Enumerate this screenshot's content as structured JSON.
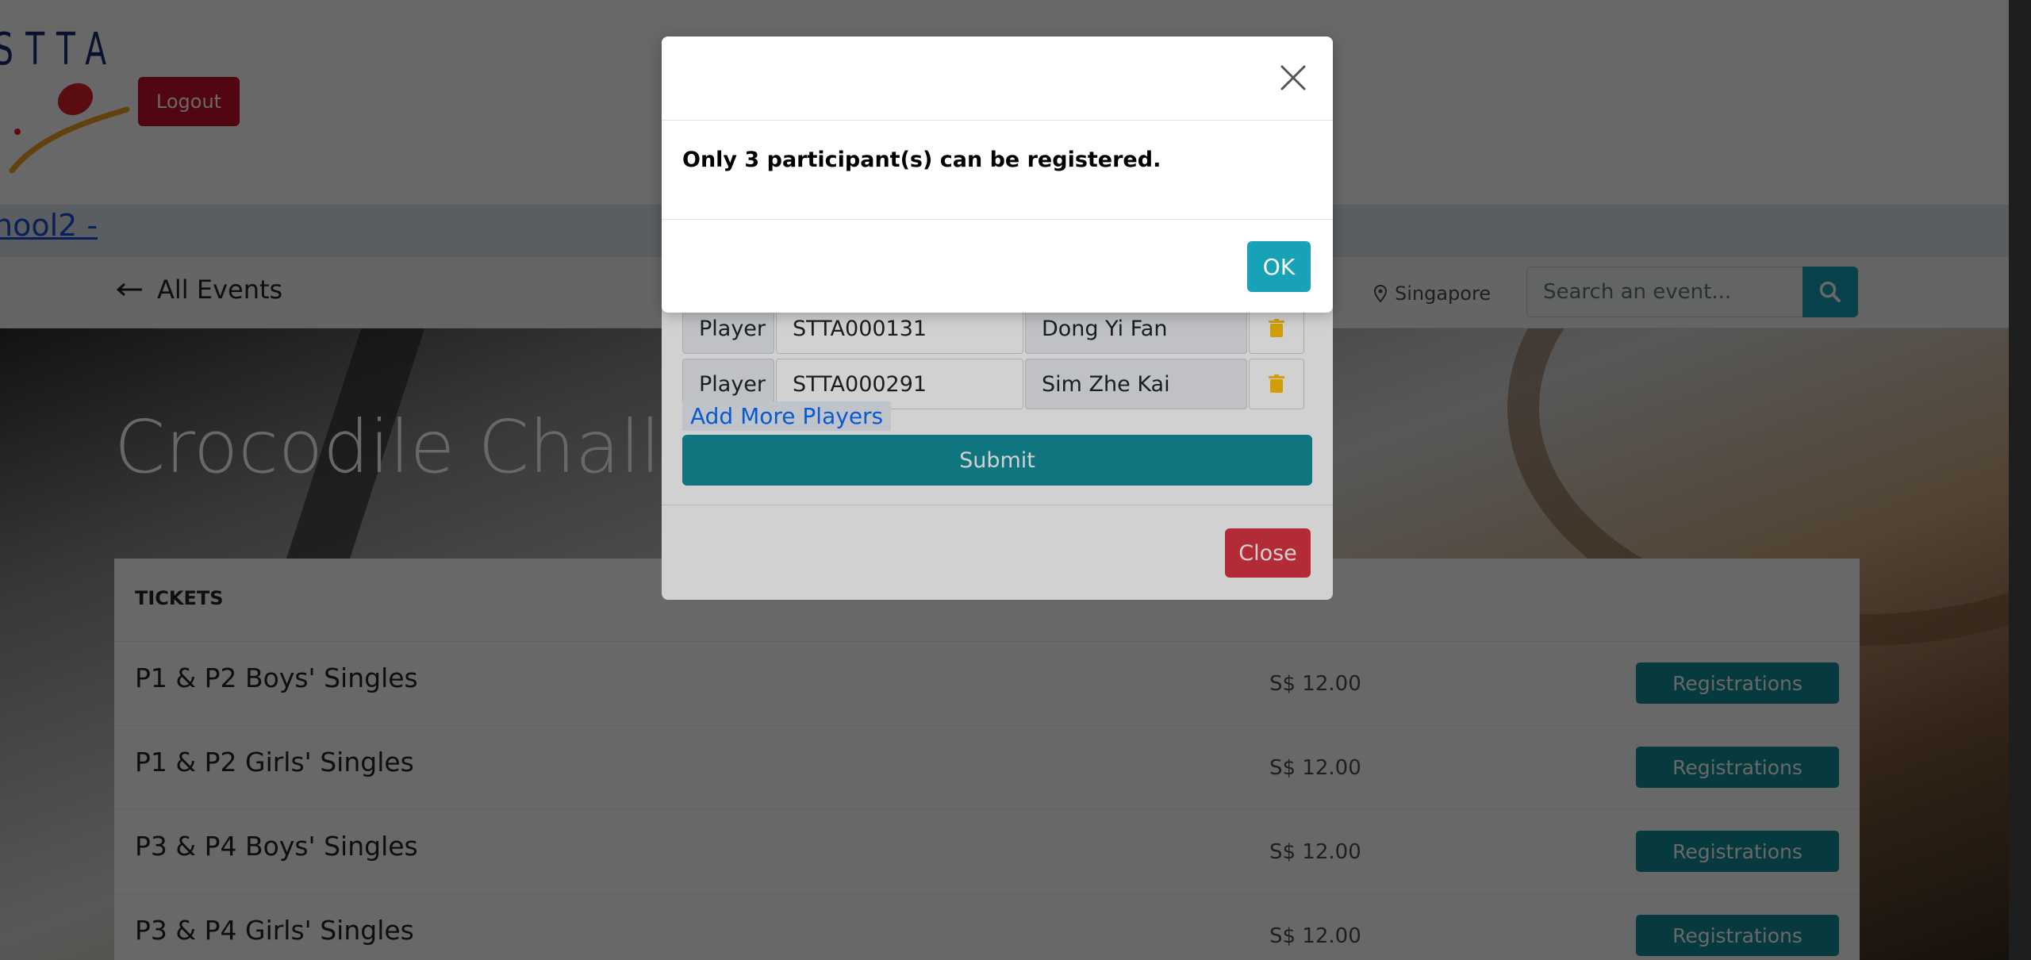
{
  "header": {
    "logo_text": "STTA",
    "logout_label": "Logout",
    "school_link": "hool2 -"
  },
  "nav": {
    "all_events_label": "All Events",
    "location": "Singapore",
    "search_placeholder": "Search an event..."
  },
  "event": {
    "title": "Crocodile Challen"
  },
  "tickets": {
    "heading": "TICKETS",
    "items": [
      {
        "name": "P1 & P2 Boys' Singles",
        "price": "S$ 12.00",
        "action": "Registrations"
      },
      {
        "name": "P1 & P2 Girls' Singles",
        "price": "S$ 12.00",
        "action": "Registrations"
      },
      {
        "name": "P3 & P4 Boys' Singles",
        "price": "S$ 12.00",
        "action": "Registrations"
      },
      {
        "name": "P3 & P4 Girls' Singles",
        "price": "S$ 12.00",
        "action": "Registrations"
      }
    ]
  },
  "players_modal": {
    "players": [
      {
        "role": "Player",
        "id": "STTA000131",
        "name": "Dong Yi Fan"
      },
      {
        "role": "Player",
        "id": "STTA000291",
        "name": "Sim Zhe Kai"
      }
    ],
    "add_more_label": "Add More Players",
    "submit_label": "Submit",
    "close_label": "Close"
  },
  "alert_modal": {
    "message": "Only 3 participant(s) can be registered.",
    "ok_label": "OK"
  },
  "colors": {
    "teal": "#17a2b8",
    "teal_dark": "#138f9c",
    "danger": "#dc3545",
    "logout": "#c8102e",
    "link": "#1d4fd8"
  },
  "icons": {
    "back": "arrow-left-icon",
    "location": "map-pin-icon",
    "search": "search-icon",
    "delete": "trash-icon",
    "close": "close-icon"
  }
}
